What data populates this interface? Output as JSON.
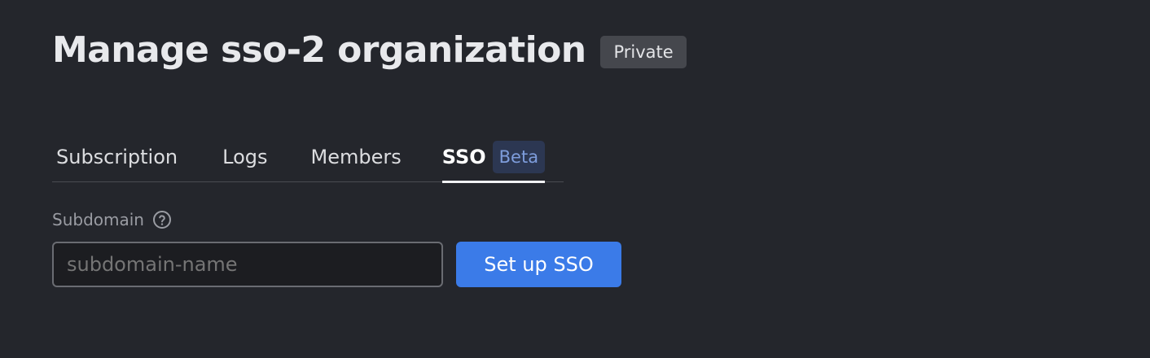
{
  "header": {
    "title": "Manage sso-2 organization",
    "visibility_badge": "Private"
  },
  "tabs": [
    {
      "label": "Subscription",
      "active": false
    },
    {
      "label": "Logs",
      "active": false
    },
    {
      "label": "Members",
      "active": false
    },
    {
      "label": "SSO",
      "active": true,
      "badge": "Beta"
    }
  ],
  "sso_form": {
    "field_label": "Subdomain",
    "help_icon": "question-circle-icon",
    "subdomain_placeholder": "subdomain-name",
    "subdomain_value": "",
    "submit_label": "Set up SSO"
  },
  "colors": {
    "background": "#24262c",
    "primary_button": "#3b7be8",
    "beta_badge_bg": "#2c3752",
    "beta_badge_text": "#7e9ddc"
  }
}
